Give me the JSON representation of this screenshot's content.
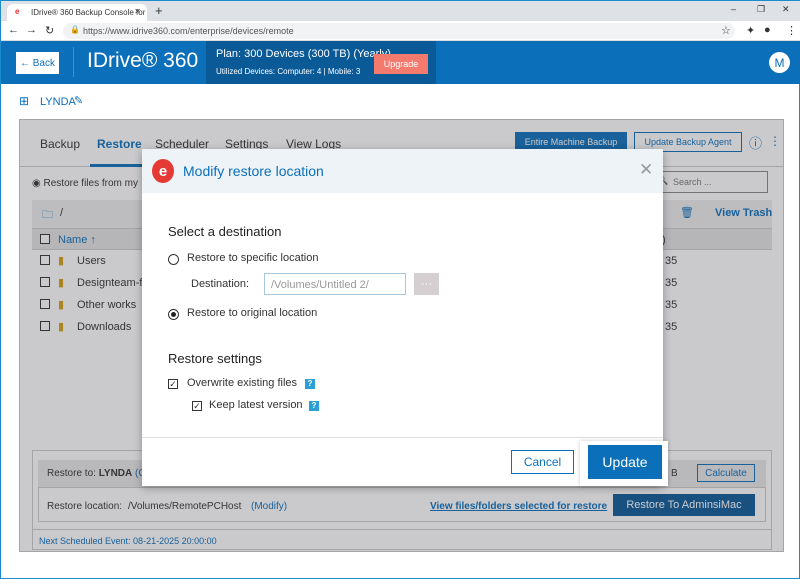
{
  "browser": {
    "tab_title": "IDrive® 360 Backup Console for",
    "url": "https://www.idrive360.com/enterprise/devices/remote"
  },
  "header": {
    "back": "← Back",
    "logo": "IDrive® 360",
    "plan": "Plan: 300 Devices (300 TB) (Yearly)",
    "utilized": "Utilized Devices: Computer: 4 |  Mobile: 3",
    "upgrade": "Upgrade",
    "avatar": "M"
  },
  "device": {
    "name": "LYNDA"
  },
  "tabs": [
    "Backup",
    "Restore",
    "Scheduler",
    "Settings",
    "View Logs"
  ],
  "actions": {
    "entire": "Entire Machine Backup",
    "update_agent": "Update Backup Agent"
  },
  "restore_from": "Restore files from my",
  "search_placeholder": "Search ...",
  "path": "/",
  "view_trash": "View Trash",
  "table": {
    "name_header": "Name ↑",
    "rows": [
      {
        "name": "Users",
        "size": "35"
      },
      {
        "name": "Designteam-fil",
        "size": "35"
      },
      {
        "name": "Other works",
        "size": "35"
      },
      {
        "name": "Downloads",
        "size": "35"
      }
    ],
    "size_header": ")"
  },
  "restore_to": {
    "label": "Restore to:",
    "device": "LYNDA",
    "open": "(C",
    "size": "B",
    "calculate": "Calculate"
  },
  "restore_location": {
    "label": "Restore location:",
    "path": "/Volumes/RemotePCHost",
    "modify": "(Modify)",
    "view_link": "View files/folders selected for restore",
    "button": "Restore To AdminsiMac"
  },
  "next_event": "Next Scheduled Event: 08-21-2025 20:00:00",
  "modal": {
    "title": "Modify restore location",
    "select_dest": "Select a destination",
    "opt_specific": "Restore to specific location",
    "dest_label": "Destination:",
    "dest_placeholder": "/Volumes/Untitled 2/",
    "browse": "···",
    "opt_original": "Restore to original location",
    "settings": "Restore settings",
    "overwrite": "Overwrite existing files",
    "keep_latest": "Keep latest version",
    "help": "?",
    "cancel": "Cancel",
    "update": "Update"
  }
}
